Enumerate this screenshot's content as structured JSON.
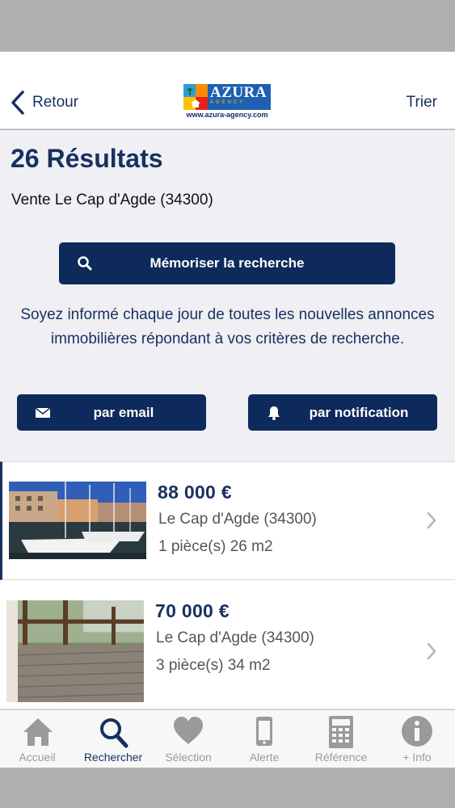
{
  "navbar": {
    "back_label": "Retour",
    "sort_label": "Trier",
    "logo": {
      "word": "AZURA",
      "sub": "AGENCY",
      "url": "www.azura-agency.com"
    }
  },
  "results": {
    "title": "26 Résultats",
    "subtitle": "Vente Le Cap d'Agde (34300)"
  },
  "save_search": {
    "label": "Mémoriser la recherche",
    "icon": "search-icon"
  },
  "info_text": "Soyez informé chaque jour de toutes les nouvelles annonces immobilières répondant à vos critères de recherche.",
  "subscribe": {
    "email_label": "par email",
    "notification_label": "par notification"
  },
  "listings": [
    {
      "price": "88 000  €",
      "city": "Le Cap d'Agde (34300)",
      "detail": "1 pièce(s) 26 m2",
      "image": "marina-photo"
    },
    {
      "price": "70 000  €",
      "city": "Le Cap d'Agde (34300)",
      "detail": "3 pièce(s) 34 m2",
      "image": "terrace-photo"
    }
  ],
  "tabs": [
    {
      "label": "Accueil",
      "icon": "home-icon"
    },
    {
      "label": "Rechercher",
      "icon": "search-icon"
    },
    {
      "label": "Sélection",
      "icon": "heart-icon"
    },
    {
      "label": "Alerte",
      "icon": "phone-icon"
    },
    {
      "label": "Référence",
      "icon": "calculator-icon"
    },
    {
      "label": "+ Info",
      "icon": "info-icon"
    }
  ],
  "colors": {
    "brand_navy": "#0e2a5c",
    "text_navy": "#17315f",
    "background": "#efeff4",
    "inactive_tab": "#9a9a9a"
  }
}
